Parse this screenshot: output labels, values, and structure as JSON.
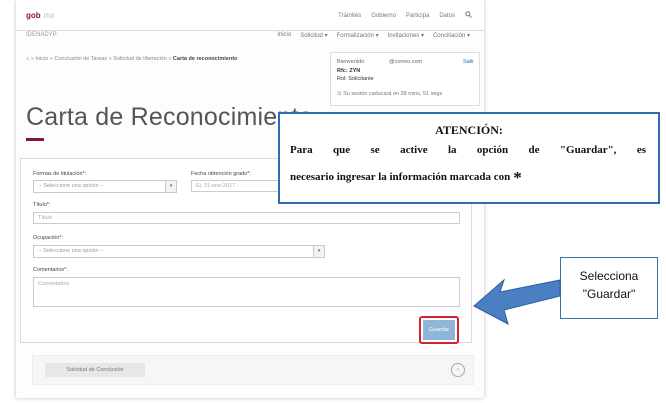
{
  "header": {
    "logo": "gob",
    "logo_suffix": "mx",
    "links": [
      "Trámites",
      "Gobierno",
      "Participa",
      "Datos"
    ],
    "agency": "IDENADYP",
    "menu": [
      "Inicio",
      "Solicitud ▾",
      "Formalización ▾",
      "Invitaciones ▾",
      "Conciliación ▾"
    ]
  },
  "breadcrumb": {
    "path": "⌂ » Inicio » Conclusión de Tareas » Solicitud de liberación » ",
    "current": "Carta de reconocimiento"
  },
  "session": {
    "label": "Bienvenido",
    "email": "@correo.com",
    "exit": "Salir",
    "rfc": "Rfc: ZYN",
    "role": "Rol: Solicitante",
    "expiry": "⊙ Su sesión caducará en 28 mins, 51 segs"
  },
  "page": {
    "title": "Carta de Reconocimiento"
  },
  "form": {
    "titulacion_label": "Formas de titulación*:",
    "titulacion_placeholder": "-- Seleccione una opción --",
    "fecha_label": "Fecha obtención grado*:",
    "fecha_placeholder": "Ej. 31-ene-2017",
    "titulo_label": "Título*:",
    "titulo_placeholder": "Título",
    "ocupacion_label": "Ocupación*:",
    "ocupacion_placeholder": "-- Seleccione una opción --",
    "comentarios_label": "Comentarios*:",
    "comentarios_placeholder": "Comentarios",
    "save_label": "Guardar"
  },
  "footer": {
    "button_label": "Solicitud de Conclusión",
    "icon": "chevron-circle-icon"
  },
  "annotation": {
    "title": "ATENCIÓN:",
    "line1": "Para que se active la opción de \"Guardar\", es",
    "line2": "necesario ingresar la información marcada con",
    "asterisk": "*",
    "select_line1": "Selecciona",
    "select_line2": "\"Guardar\"",
    "callout_border": "#2d6bb5",
    "arrow_color": "#4a7fc4",
    "highlight_color": "#d4242b"
  }
}
